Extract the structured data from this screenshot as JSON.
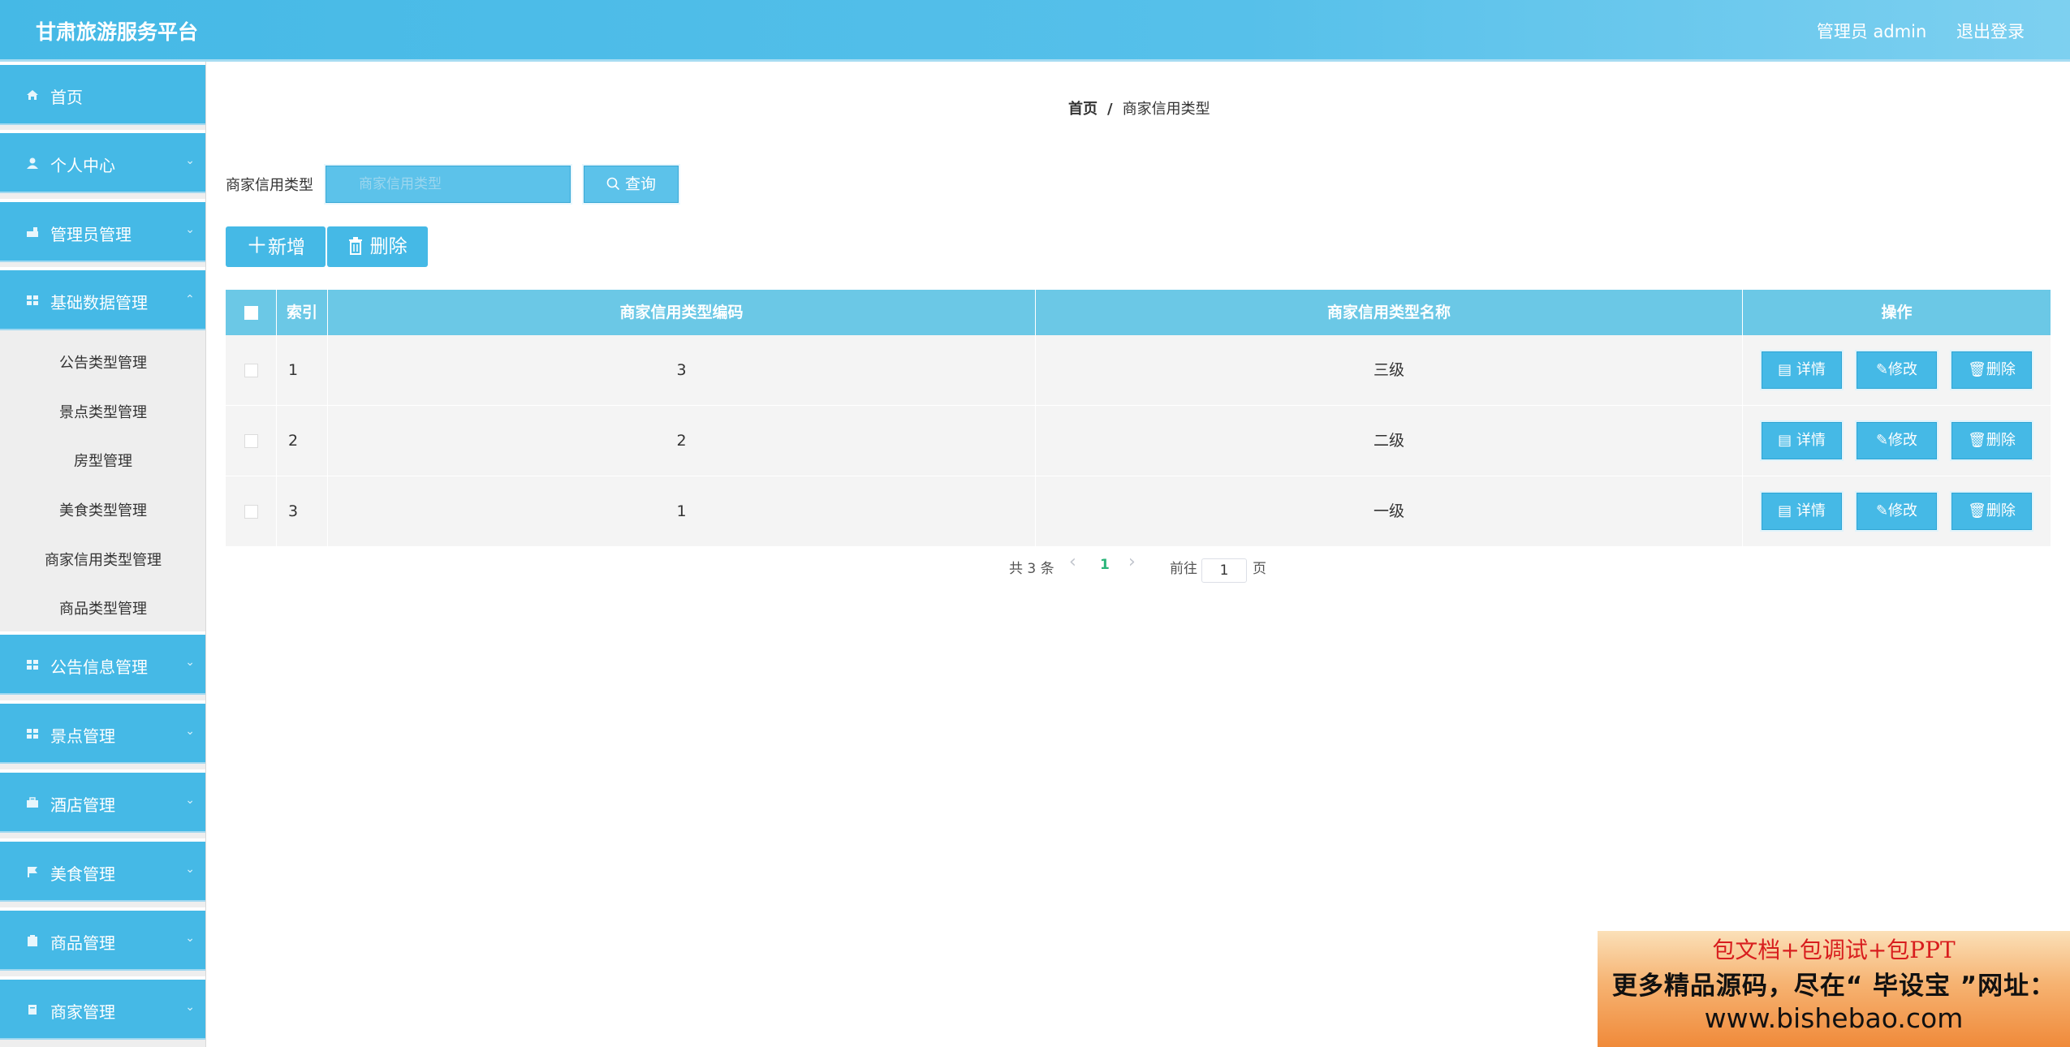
{
  "header": {
    "title": "甘肃旅游服务平台",
    "user": "管理员 admin",
    "logout": "退出登录"
  },
  "sidebar": {
    "menus": [
      {
        "label": "首页",
        "icon": "home-icon"
      },
      {
        "label": "个人中心",
        "icon": "user-icon"
      },
      {
        "label": "管理员管理",
        "icon": "admin-icon"
      },
      {
        "label": "基础数据管理",
        "icon": "grid-icon"
      },
      {
        "label": "公告信息管理",
        "icon": "grid-icon"
      },
      {
        "label": "景点管理",
        "icon": "grid-icon"
      },
      {
        "label": "酒店管理",
        "icon": "briefcase-icon"
      },
      {
        "label": "美食管理",
        "icon": "flag-icon"
      },
      {
        "label": "商品管理",
        "icon": "clipboard-icon"
      },
      {
        "label": "商家管理",
        "icon": "bookmark-icon"
      }
    ],
    "submenu": [
      "公告类型管理",
      "景点类型管理",
      "房型管理",
      "美食类型管理",
      "商家信用类型管理",
      "商品类型管理"
    ],
    "chevron": "⌄"
  },
  "breadcrumb": {
    "home": "首页",
    "sep": "/",
    "current": "商家信用类型"
  },
  "search": {
    "label": "商家信用类型",
    "placeholder": "商家信用类型",
    "button": "查询"
  },
  "toolbar": {
    "add": "新增",
    "delete": "删除"
  },
  "table": {
    "headers": [
      "索引",
      "商家信用类型编码",
      "商家信用类型名称",
      "操作"
    ],
    "rows": [
      {
        "index": "1",
        "code": "3",
        "name": "三级"
      },
      {
        "index": "2",
        "code": "2",
        "name": "二级"
      },
      {
        "index": "3",
        "code": "1",
        "name": "一级"
      }
    ],
    "actions": {
      "detail": "详情",
      "edit": "修改",
      "delete": "删除"
    }
  },
  "pagination": {
    "total": "共 3 条",
    "current": "1",
    "goto": "前往",
    "page_input": "1",
    "page_unit": "页",
    "prev": "‹",
    "next": "›"
  },
  "ad": {
    "line1": "包文档+包调试+包PPT",
    "line2": "更多精品源码，尽在“ 毕设宝 ”网址：",
    "line3": "www.bishebao.com"
  }
}
